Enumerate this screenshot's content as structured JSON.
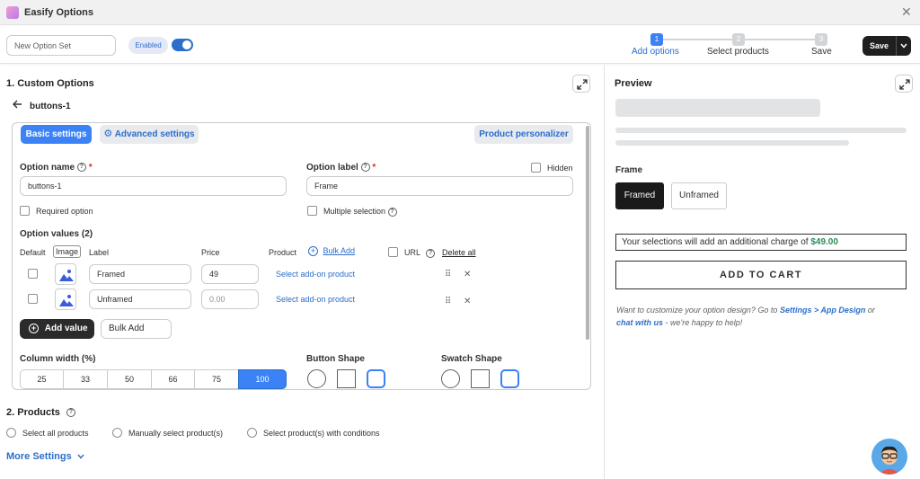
{
  "window": {
    "title": "Easify Options",
    "close_glyph": "✕"
  },
  "topbar": {
    "name_placeholder": "New Option Set",
    "enabled_label": "Enabled",
    "enabled": true,
    "steps": [
      {
        "num": "1",
        "label": "Add options",
        "active": true
      },
      {
        "num": "2",
        "label": "Select products",
        "active": false
      },
      {
        "num": "3",
        "label": "Save",
        "active": false
      }
    ],
    "save_label": "Save"
  },
  "custom_options": {
    "heading": "1. Custom Options",
    "back_title": "buttons-1",
    "tabs": {
      "basic": "Basic settings",
      "advanced": "Advanced settings",
      "personalizer": "Product personalizer"
    },
    "option_name_label": "Option name",
    "option_name_value": "buttons-1",
    "option_label_label": "Option label",
    "option_label_value": "Frame",
    "hidden_label": "Hidden",
    "required_label": "Required option",
    "multiple_label": "Multiple selection",
    "values_heading": "Option values (2)",
    "columns": {
      "default": "Default",
      "image": "Image",
      "label": "Label",
      "price": "Price",
      "product": "Product",
      "bulk_add": "Bulk Add",
      "url": "URL",
      "delete_all": "Delete all"
    },
    "rows": [
      {
        "label": "Framed",
        "price": "49",
        "price_placeholder": "",
        "product_link": "Select add-on product"
      },
      {
        "label": "Unframed",
        "price": "",
        "price_placeholder": "0.00",
        "product_link": "Select add-on product"
      }
    ],
    "add_value_label": "Add value",
    "bulk_add_label": "Bulk Add",
    "column_width_label": "Column width (%)",
    "column_widths": [
      "25",
      "33",
      "50",
      "66",
      "75",
      "100"
    ],
    "column_width_selected": "100",
    "button_shape_label": "Button Shape",
    "swatch_shape_label": "Swatch Shape"
  },
  "products": {
    "heading": "2. Products",
    "options": [
      "Select all products",
      "Manually select product(s)",
      "Select product(s) with conditions"
    ]
  },
  "more_settings_label": "More Settings",
  "preview": {
    "heading": "Preview",
    "frame_label": "Frame",
    "options": [
      "Framed",
      "Unframed"
    ],
    "charge_text": "Your selections will add an additional charge of",
    "charge_amount": "$49.00",
    "cart_label": "ADD TO CART",
    "note_prefix": "Want to customize your option design? Go to",
    "note_link1": "Settings > App Design",
    "note_mid": "or",
    "note_link2": "chat with us",
    "note_suffix": "- we're happy to help!"
  },
  "colors": {
    "accent": "#3b82f6",
    "link": "#2c6ecb",
    "charge": "#2e8b57",
    "dark": "#1f1f1f"
  }
}
